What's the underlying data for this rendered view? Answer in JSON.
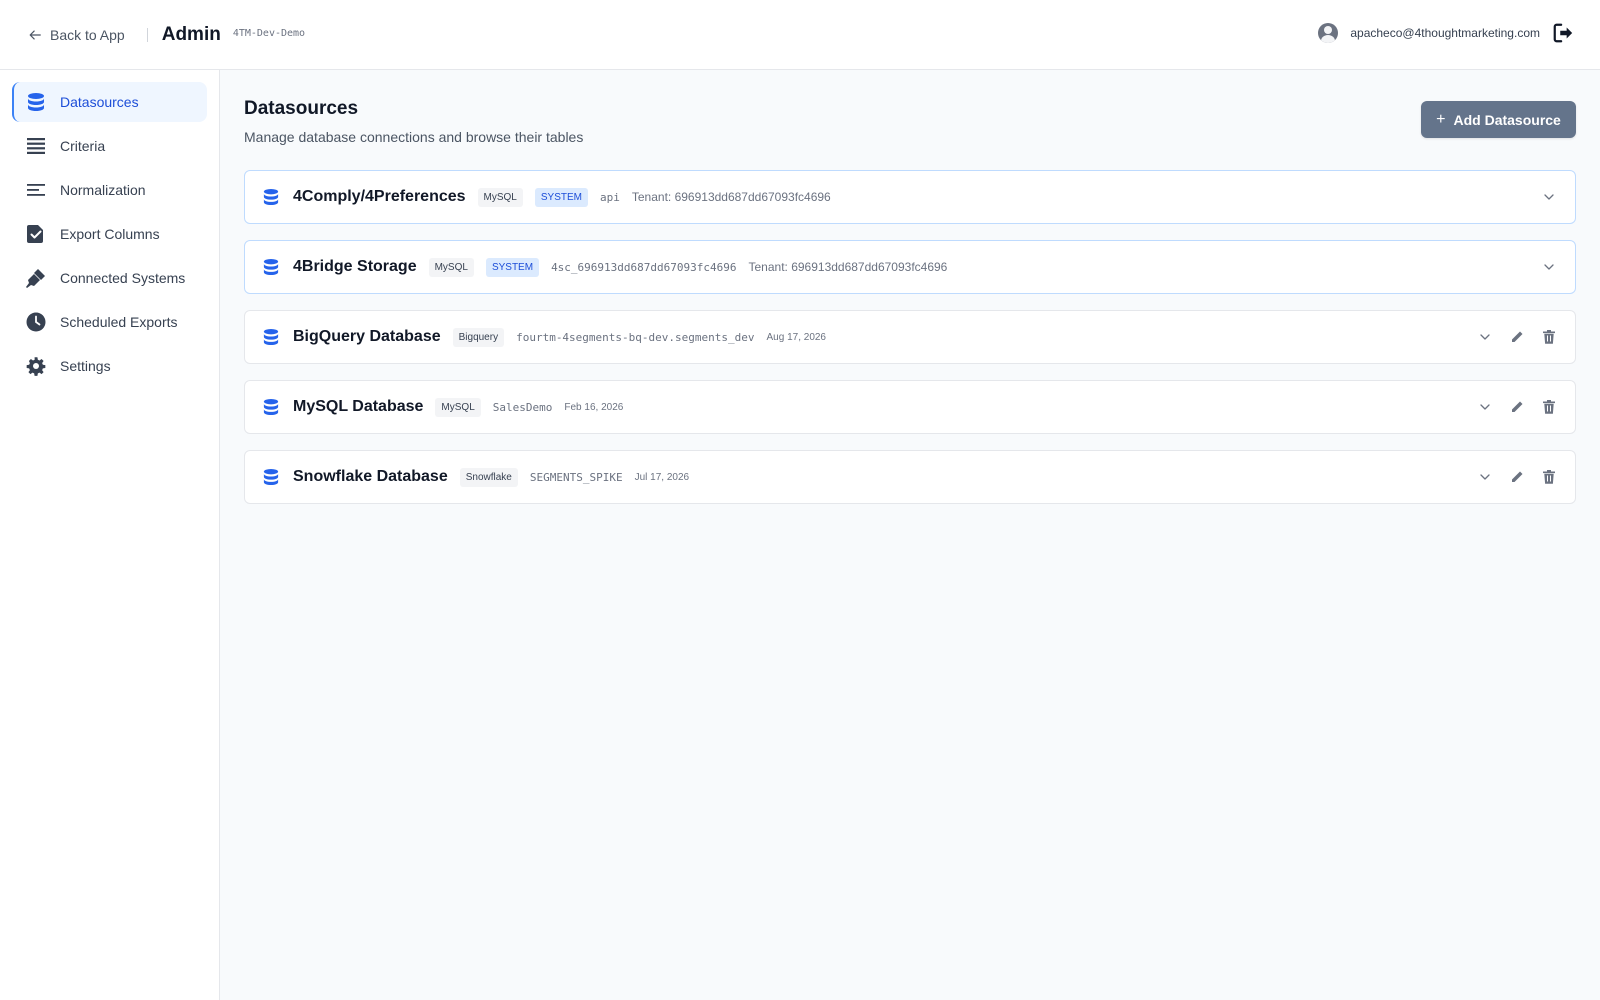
{
  "header": {
    "back_label": "Back to App",
    "title": "Admin",
    "tenant": "4TM-Dev-Demo",
    "user_email": "apacheco@4thoughtmarketing.com"
  },
  "sidebar": {
    "items": [
      {
        "label": "Datasources",
        "icon": "database-icon",
        "active": true
      },
      {
        "label": "Criteria",
        "icon": "list-icon",
        "active": false
      },
      {
        "label": "Normalization",
        "icon": "align-left-icon",
        "active": false
      },
      {
        "label": "Export Columns",
        "icon": "check-square-icon",
        "active": false
      },
      {
        "label": "Connected Systems",
        "icon": "plug-icon",
        "active": false
      },
      {
        "label": "Scheduled Exports",
        "icon": "clock-icon",
        "active": false
      },
      {
        "label": "Settings",
        "icon": "gear-icon",
        "active": false
      }
    ]
  },
  "main": {
    "title": "Datasources",
    "subtitle": "Manage database connections and browse their tables",
    "add_button_label": "Add Datasource"
  },
  "datasources": [
    {
      "name": "4Comply/4Preferences",
      "type": "MySQL",
      "system_badge": "SYSTEM",
      "database": "api",
      "tenant": "Tenant: 696913dd687dd67093fc4696",
      "date": ""
    },
    {
      "name": "4Bridge Storage",
      "type": "MySQL",
      "system_badge": "SYSTEM",
      "database": "4sc_696913dd687dd67093fc4696",
      "tenant": "Tenant: 696913dd687dd67093fc4696",
      "date": ""
    },
    {
      "name": "BigQuery Database",
      "type": "Bigquery",
      "system_badge": "",
      "database": "fourtm-4segments-bq-dev.segments_dev",
      "tenant": "",
      "date": "Aug 17, 2026"
    },
    {
      "name": "MySQL Database",
      "type": "MySQL",
      "system_badge": "",
      "database": "SalesDemo",
      "tenant": "",
      "date": "Feb 16, 2026"
    },
    {
      "name": "Snowflake Database",
      "type": "Snowflake",
      "system_badge": "",
      "database": "SEGMENTS_SPIKE",
      "tenant": "",
      "date": "Jul 17, 2026"
    }
  ],
  "colors": {
    "accent": "#2563eb",
    "active_bg": "#eff6ff",
    "button_bg": "#64748b",
    "system_badge_bg": "#dbeafe"
  }
}
